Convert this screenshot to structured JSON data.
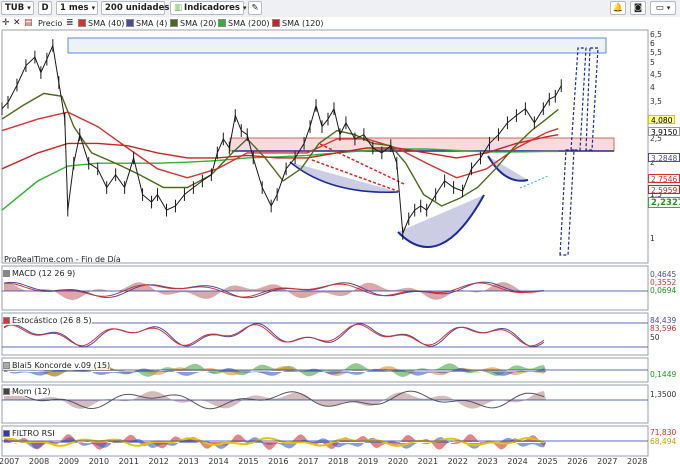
{
  "toolbar": {
    "ticker": "TUB",
    "d_label": "D",
    "period": "1 mes",
    "units": "200 unidades",
    "indicators": "Indicadores"
  },
  "legend": {
    "price": "Precio",
    "sma40": "SMA (40)",
    "sma4": "SMA (4)",
    "sma20": "SMA (20)",
    "sma200": "SMA (200)",
    "sma120": "SMA (120)"
  },
  "colors": {
    "price": "#1a1a1a",
    "sma40": "#d93030",
    "sma4": "#4b4b99",
    "sma20": "#4a6b1a",
    "sma200": "#2ab52a",
    "sma120": "#cc2222",
    "panel_border": "#9aa0aa"
  },
  "source_label": "ProRealTime.com - Fin de Día",
  "price_axis": [
    "6,5",
    "6",
    "5,5",
    "5",
    "4,5",
    "4",
    "3,5",
    "3",
    "2,5",
    "2",
    "1,5",
    "1"
  ],
  "price_tags": {
    "last": "4,080",
    "high": "3,9150",
    "sma4": "3,2848",
    "sma40": "2,7546",
    "sma120": "2,5959",
    "sma200": "2,2327"
  },
  "panels": {
    "macd": {
      "title": "MACD (12 26 9)",
      "v1": "0,4645",
      "v2": "0,3552",
      "v3": "0,0694"
    },
    "stoch": {
      "title": "Estocástico (26 8 5)",
      "v1": "84,439",
      "v2": "83,596",
      "axis_mid": "50"
    },
    "blai": {
      "title": "Blai5 Koncorde v.09 (15)",
      "v1": "0,1449"
    },
    "mom": {
      "title": "Mom (12)",
      "v1": "1,3500"
    },
    "rsi": {
      "title": "FILTRO RSI",
      "v1": "71,830",
      "v2": "68,494"
    }
  },
  "years": [
    "2007",
    "2008",
    "2009",
    "2010",
    "2011",
    "2012",
    "2013",
    "2014",
    "2015",
    "2016",
    "2017",
    "2018",
    "2019",
    "2020",
    "2021",
    "2022",
    "2023",
    "2024",
    "2025",
    "2026",
    "2027",
    "2028"
  ],
  "chart_data": {
    "type": "line",
    "x_unit": "year",
    "xlim": [
      2006.8,
      2028.4
    ],
    "ylim": [
      0.8,
      6.8
    ],
    "y_scale": "log",
    "series": [
      {
        "name": "Precio",
        "color": "#1a1a1a",
        "x": [
          2006.8,
          2007.0,
          2007.3,
          2007.6,
          2007.9,
          2008.1,
          2008.3,
          2008.5,
          2008.7,
          2008.9,
          2009.0,
          2009.2,
          2009.4,
          2009.7,
          2010.0,
          2010.3,
          2010.6,
          2010.9,
          2011.2,
          2011.5,
          2011.8,
          2012.0,
          2012.3,
          2012.6,
          2012.9,
          2013.2,
          2013.5,
          2013.8,
          2014.0,
          2014.2,
          2014.4,
          2014.6,
          2014.8,
          2015.0,
          2015.2,
          2015.5,
          2015.8,
          2016.0,
          2016.3,
          2016.6,
          2016.9,
          2017.1,
          2017.3,
          2017.5,
          2017.7,
          2017.9,
          2018.1,
          2018.3,
          2018.6,
          2018.9,
          2019.2,
          2019.5,
          2019.8,
          2020.0,
          2020.2,
          2020.4,
          2020.6,
          2020.8,
          2021.0,
          2021.3,
          2021.6,
          2021.9,
          2022.2,
          2022.5,
          2022.8,
          2023.1,
          2023.4,
          2023.7,
          2024.0,
          2024.3,
          2024.6,
          2024.9,
          2025.1,
          2025.3,
          2025.5
        ],
        "y": [
          3.3,
          3.5,
          4.1,
          4.9,
          5.3,
          4.6,
          5.2,
          5.9,
          4.2,
          3.0,
          1.3,
          2.0,
          2.6,
          2.0,
          1.9,
          1.6,
          1.8,
          1.6,
          2.1,
          1.5,
          1.4,
          1.5,
          1.3,
          1.35,
          1.5,
          1.6,
          1.7,
          1.8,
          2.2,
          2.5,
          2.3,
          3.1,
          2.7,
          2.6,
          2.1,
          1.6,
          1.35,
          1.5,
          1.9,
          2.1,
          2.4,
          2.8,
          3.4,
          2.8,
          3.0,
          3.3,
          2.6,
          2.9,
          2.5,
          2.6,
          2.3,
          2.2,
          2.35,
          2.0,
          1.05,
          1.2,
          1.3,
          1.35,
          1.3,
          1.5,
          1.7,
          1.6,
          1.55,
          1.9,
          2.1,
          2.4,
          2.6,
          2.9,
          3.1,
          3.3,
          2.9,
          3.3,
          3.6,
          3.7,
          4.08
        ]
      },
      {
        "name": "SMA (20)",
        "color": "#4a6b1a",
        "x": [
          2006.8,
          2007.5,
          2008.2,
          2008.8,
          2009.2,
          2009.8,
          2010.6,
          2011.4,
          2012.2,
          2013.0,
          2013.8,
          2014.5,
          2015.0,
          2015.6,
          2016.2,
          2016.8,
          2017.4,
          2018.0,
          2018.6,
          2019.2,
          2019.8,
          2020.3,
          2020.9,
          2021.5,
          2022.1,
          2022.7,
          2023.3,
          2023.9,
          2024.5,
          2025.0,
          2025.4
        ],
        "y": [
          3.0,
          3.4,
          3.8,
          3.7,
          2.8,
          2.2,
          2.0,
          1.8,
          1.6,
          1.6,
          1.8,
          2.2,
          2.5,
          2.1,
          1.7,
          1.9,
          2.4,
          2.7,
          2.6,
          2.4,
          2.35,
          2.0,
          1.5,
          1.35,
          1.45,
          1.6,
          1.9,
          2.3,
          2.7,
          3.0,
          3.28
        ]
      },
      {
        "name": "SMA (40)",
        "color": "#d93030",
        "x": [
          2006.8,
          2008.0,
          2009.0,
          2010.0,
          2011.0,
          2012.0,
          2013.0,
          2014.0,
          2015.0,
          2016.0,
          2017.0,
          2018.0,
          2019.0,
          2020.0,
          2021.0,
          2022.0,
          2023.0,
          2024.0,
          2025.0,
          2025.4
        ],
        "y": [
          2.7,
          3.0,
          3.2,
          2.8,
          2.3,
          1.9,
          1.75,
          1.9,
          2.2,
          2.2,
          2.2,
          2.5,
          2.5,
          2.3,
          2.0,
          1.75,
          1.9,
          2.3,
          2.65,
          2.75
        ]
      },
      {
        "name": "SMA (200)",
        "color": "#2ab52a",
        "x": [
          2006.8,
          2008.0,
          2009.0,
          2010.0,
          2011.0,
          2012.0,
          2013.0,
          2014.0,
          2015.0,
          2016.0,
          2017.0,
          2018.0,
          2019.0,
          2020.0,
          2021.0,
          2022.0,
          2023.0,
          2024.0,
          2025.0,
          2025.4
        ],
        "y": [
          1.3,
          1.7,
          1.95,
          2.0,
          2.0,
          2.0,
          2.02,
          2.05,
          2.1,
          2.12,
          2.15,
          2.2,
          2.25,
          2.28,
          2.28,
          2.25,
          2.22,
          2.22,
          2.23,
          2.23
        ]
      },
      {
        "name": "SMA (120)",
        "color": "#cc2222",
        "x": [
          2006.8,
          2008.0,
          2009.0,
          2010.0,
          2011.0,
          2012.0,
          2013.0,
          2014.0,
          2015.0,
          2016.0,
          2017.0,
          2018.0,
          2019.0,
          2020.0,
          2021.0,
          2022.0,
          2023.0,
          2024.0,
          2025.0,
          2025.4
        ],
        "y": [
          1.9,
          2.2,
          2.4,
          2.4,
          2.35,
          2.2,
          2.1,
          2.1,
          2.15,
          2.1,
          2.1,
          2.2,
          2.3,
          2.3,
          2.2,
          2.1,
          2.2,
          2.4,
          2.55,
          2.6
        ]
      }
    ]
  }
}
